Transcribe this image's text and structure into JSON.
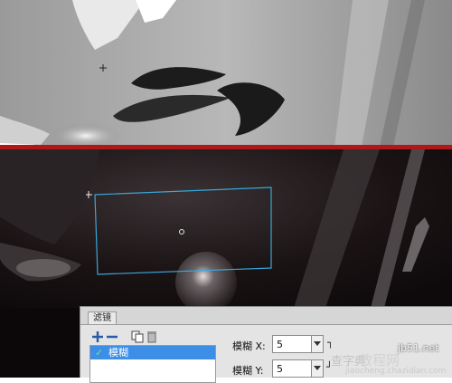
{
  "panel": {
    "tab_title": "滤镜",
    "add_icon": "plus-icon",
    "remove_icon": "minus-icon",
    "duplicate_icon": "duplicate-icon",
    "delete_icon": "trash-icon",
    "filters": [
      {
        "label": "模糊",
        "checked": true,
        "selected": true
      }
    ],
    "blur_x": {
      "label": "模糊 X:",
      "value": "5"
    },
    "blur_y": {
      "label": "模糊 Y:",
      "value": "5"
    }
  },
  "canvas": {
    "selection_color": "#3aa6d8",
    "divider_color": "#b01818"
  },
  "watermark": {
    "site": "jb51.net",
    "brand": "查字典",
    "text": "教程网",
    "domain": "jiaocheng.chazidian.com"
  }
}
